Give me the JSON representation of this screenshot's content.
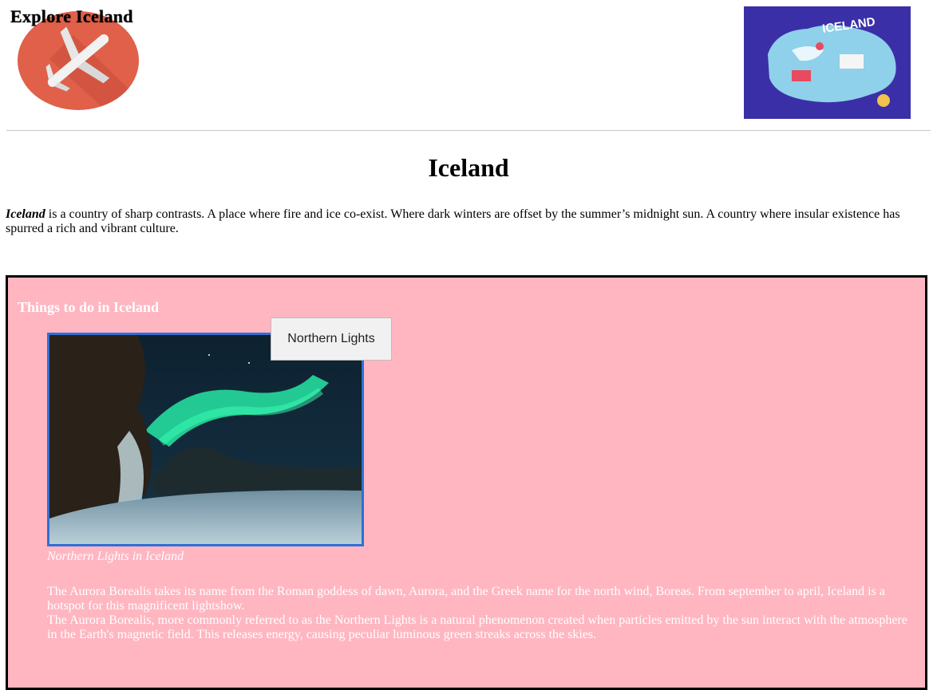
{
  "header": {
    "site_title": "Explore Iceland",
    "logo_icon": "airplane-icon",
    "map_image_text": "ICELAND"
  },
  "intro": {
    "heading": "Iceland",
    "lead_word": "Iceland",
    "body": " is a country of sharp contrasts. A place where fire and ice co-exist. Where dark winters are offset by the summer’s midnight sun. A country where insular existence has spurred a rich and vibrant culture."
  },
  "things": {
    "title": "Things to do in Iceland",
    "photo_tooltip": "Northern Lights",
    "caption": "Northern Lights in Iceland",
    "paragraph_1": "The Aurora Borealis takes its name from the Roman goddess of dawn, Aurora, and the Greek name for the north wind, Boreas. From september to april, Iceland is a hotspot for this magnificent lightshow.",
    "paragraph_2": "The Aurora Borealis, more commonly referred to as the Northern Lights is a natural phenomenon created when particles emitted by the sun interact with the atmosphere in the Earth's magnetic field. This releases energy, causing peculiar luminous green streaks across the skies."
  },
  "colors": {
    "section_background": "#ffb6c1",
    "logo_circle": "#e0604a",
    "photo_border": "#2f6fd6"
  }
}
